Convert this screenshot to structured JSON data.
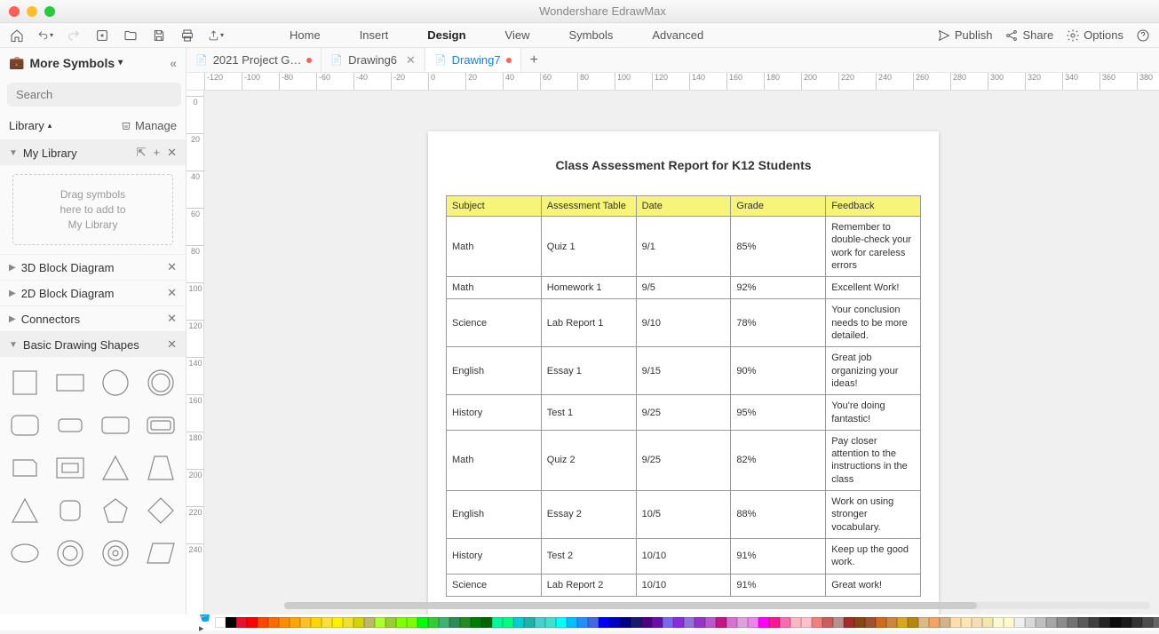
{
  "app_title": "Wondershare EdrawMax",
  "menu": [
    "Home",
    "Insert",
    "Design",
    "View",
    "Symbols",
    "Advanced"
  ],
  "menu_active": "Design",
  "actions": {
    "publish": "Publish",
    "share": "Share",
    "options": "Options"
  },
  "sidebar": {
    "title": "More Symbols",
    "search_placeholder": "Search",
    "search_btn": "Search",
    "library_label": "Library",
    "manage_label": "Manage",
    "dropzone": "Drag symbols\nhere to add to\nMy Library",
    "categories": [
      {
        "name": "My Library",
        "open": true,
        "hasAddClose": true
      },
      {
        "name": "3D Block Diagram",
        "open": false,
        "hasAddClose": false
      },
      {
        "name": "2D Block Diagram",
        "open": false,
        "hasAddClose": false
      },
      {
        "name": "Connectors",
        "open": false,
        "hasAddClose": false
      },
      {
        "name": "Basic Drawing Shapes",
        "open": true,
        "hasAddClose": false
      }
    ]
  },
  "tabs": [
    {
      "label": "2021 Project G…",
      "active": false,
      "modified": true,
      "closable": false
    },
    {
      "label": "Drawing6",
      "active": false,
      "modified": false,
      "closable": true
    },
    {
      "label": "Drawing7",
      "active": true,
      "modified": true,
      "closable": false
    }
  ],
  "ruler_h": [
    -120,
    -100,
    -80,
    -60,
    -40,
    -20,
    0,
    20,
    40,
    60,
    80,
    100,
    120,
    140,
    160,
    180,
    200,
    220,
    240,
    260,
    280,
    300,
    320,
    340,
    360,
    380
  ],
  "ruler_v": [
    0,
    20,
    40,
    60,
    80,
    100,
    120,
    140,
    160,
    180,
    200,
    220,
    240
  ],
  "document": {
    "title": "Class Assessment Report for K12 Students",
    "headers": [
      "Subject",
      "Assessment Table",
      "Date",
      "Grade",
      "Feedback"
    ],
    "rows": [
      [
        "Math",
        "Quiz 1",
        "9/1",
        "85%",
        "Remember to double-check your work for careless errors"
      ],
      [
        "Math",
        "Homework 1",
        "9/5",
        "92%",
        "Excellent Work!"
      ],
      [
        "Science",
        "Lab Report 1",
        "9/10",
        "78%",
        "Your conclusion needs to be more detailed."
      ],
      [
        "English",
        "Essay 1",
        "9/15",
        "90%",
        "Great job organizing your ideas!"
      ],
      [
        "History",
        "Test 1",
        "9/25",
        "95%",
        "You're doing fantastic!"
      ],
      [
        "Math",
        "Quiz 2",
        "9/25",
        "82%",
        "Pay closer attention to the instructions in the class"
      ],
      [
        "English",
        "Essay 2",
        "10/5",
        "88%",
        "Work on using stronger vocabulary."
      ],
      [
        "History",
        "Test 2",
        "10/10",
        "91%",
        "Keep up the good work."
      ],
      [
        "Science",
        "Lab Report 2",
        "10/10",
        "91%",
        "Great work!"
      ]
    ]
  },
  "swatches": [
    "#ffffff",
    "#000000",
    "#e8112d",
    "#ff0000",
    "#ff4500",
    "#ff6a00",
    "#ff8c00",
    "#ffa500",
    "#ffc125",
    "#ffd700",
    "#ffe135",
    "#fff000",
    "#f0e130",
    "#d4d400",
    "#bdb76b",
    "#adff2f",
    "#9acd32",
    "#7fff00",
    "#7cfc00",
    "#00ff00",
    "#32cd32",
    "#3cb371",
    "#2e8b57",
    "#228b22",
    "#008000",
    "#006400",
    "#00fa9a",
    "#00ff7f",
    "#00ced1",
    "#20b2aa",
    "#48d1cc",
    "#40e0d0",
    "#00ffff",
    "#00bfff",
    "#1e90ff",
    "#4169e1",
    "#0000ff",
    "#0000cd",
    "#00008b",
    "#191970",
    "#4b0082",
    "#6a0dad",
    "#7b68ee",
    "#8a2be2",
    "#9370db",
    "#9932cc",
    "#ba55d3",
    "#c71585",
    "#da70d6",
    "#dda0dd",
    "#ee82ee",
    "#ff00ff",
    "#ff1493",
    "#ff69b4",
    "#ffb6c1",
    "#ffc0cb",
    "#f08080",
    "#cd5c5c",
    "#bc8f8f",
    "#a52a2a",
    "#8b4513",
    "#a0522d",
    "#d2691e",
    "#cd853f",
    "#daa520",
    "#b8860b",
    "#deb887",
    "#f4a460",
    "#d2b48c",
    "#ffdead",
    "#ffe4b5",
    "#f5deb3",
    "#eee8aa",
    "#fafad2",
    "#fffacd",
    "#f0f0f0",
    "#d9d9d9",
    "#bfbfbf",
    "#a6a6a6",
    "#8c8c8c",
    "#737373",
    "#595959",
    "#404040",
    "#262626",
    "#0d0d0d",
    "#1a1a1a",
    "#333333",
    "#4d4d4d",
    "#666666"
  ]
}
